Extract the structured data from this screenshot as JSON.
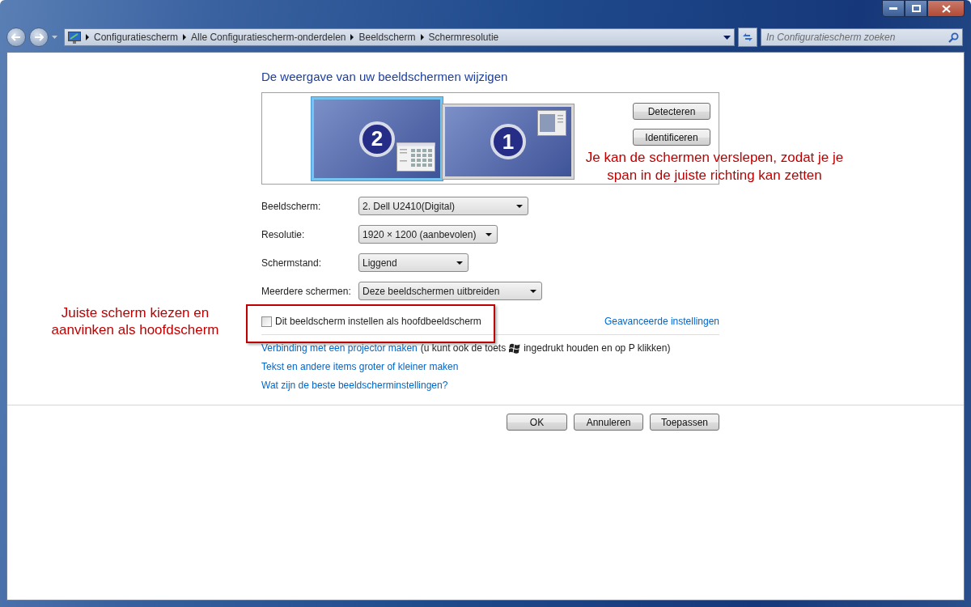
{
  "breadcrumb": [
    "Configuratiescherm",
    "Alle Configuratiescherm-onderdelen",
    "Beeldscherm",
    "Schermresolutie"
  ],
  "search": {
    "placeholder": "In Configuratiescherm zoeken"
  },
  "heading": "De weergave van uw beeldschermen wijzigen",
  "monitors": [
    {
      "number": "2",
      "selected": true,
      "kind": "grid"
    },
    {
      "number": "1",
      "selected": false,
      "kind": "document"
    }
  ],
  "monitor_buttons": [
    "Detecteren",
    "Identificeren"
  ],
  "settings": [
    {
      "label": "Beeldscherm:",
      "value": "2. Dell U2410(Digital)"
    },
    {
      "label": "Resolutie:",
      "value": "1920 × 1200 (aanbevolen)"
    },
    {
      "label": "Schermstand:",
      "value": "Liggend"
    },
    {
      "label": "Meerdere schermen:",
      "value": "Deze beeldschermen uitbreiden"
    }
  ],
  "primary_checkbox": {
    "label": "Dit beeldscherm instellen als hoofdbeeldscherm",
    "checked": false
  },
  "advanced_link": "Geavanceerde instellingen",
  "projector": {
    "link": "Verbinding met een projector maken",
    "before_key": "(u kunt ook de toets",
    "after_key": "ingedrukt houden en op P klikken)"
  },
  "links": [
    "Tekst en andere items groter of kleiner maken",
    "Wat zijn de beste beeldscherminstellingen?"
  ],
  "footer_buttons": [
    "OK",
    "Annuleren",
    "Toepassen"
  ],
  "annotations": [
    {
      "text": "Je kan de schermen verslepen, zodat je je span in de juiste richting kan zetten"
    },
    {
      "text": "Juiste scherm kiezen en aanvinken als hoofdscherm"
    }
  ]
}
